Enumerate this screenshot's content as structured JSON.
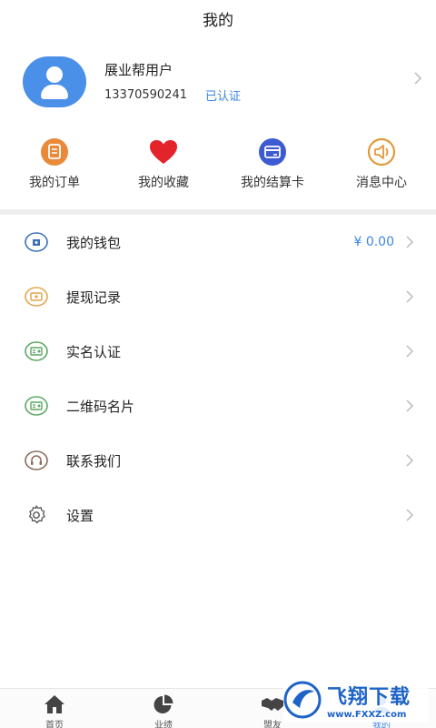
{
  "header": {
    "title": "我的"
  },
  "profile": {
    "name": "展业帮用户",
    "phone": "13370590241",
    "verified": "已认证",
    "avatar_icon": "user-avatar-icon"
  },
  "quick_actions": [
    {
      "label": "我的订单",
      "icon": "order-icon",
      "color": "#e88a3a"
    },
    {
      "label": "我的收藏",
      "icon": "heart-icon",
      "color": "#e3242b"
    },
    {
      "label": "我的结算卡",
      "icon": "card-icon",
      "color": "#3d5bd1"
    },
    {
      "label": "消息中心",
      "icon": "speaker-icon",
      "color": "#e39a3b"
    }
  ],
  "menu": [
    {
      "label": "我的钱包",
      "icon": "wallet-icon",
      "value": "¥ 0.00"
    },
    {
      "label": "提现记录",
      "icon": "withdraw-icon"
    },
    {
      "label": "实名认证",
      "icon": "id-card-icon"
    },
    {
      "label": "二维码名片",
      "icon": "qr-card-icon"
    },
    {
      "label": "联系我们",
      "icon": "headset-icon"
    },
    {
      "label": "设置",
      "icon": "gear-icon"
    }
  ],
  "bottom_nav": [
    {
      "label": "首页",
      "icon": "home-icon"
    },
    {
      "label": "业绩",
      "icon": "pie-chart-icon"
    },
    {
      "label": "盟友",
      "icon": "handshake-icon"
    },
    {
      "label": "我的",
      "icon": "me-icon",
      "active": true
    }
  ],
  "watermark": {
    "name": "飞翔下载",
    "url": "www.FXXZ.com"
  },
  "colors": {
    "accent": "#3b86e0",
    "avatar_bg": "#4a8fe8",
    "divider": "#efefef"
  }
}
